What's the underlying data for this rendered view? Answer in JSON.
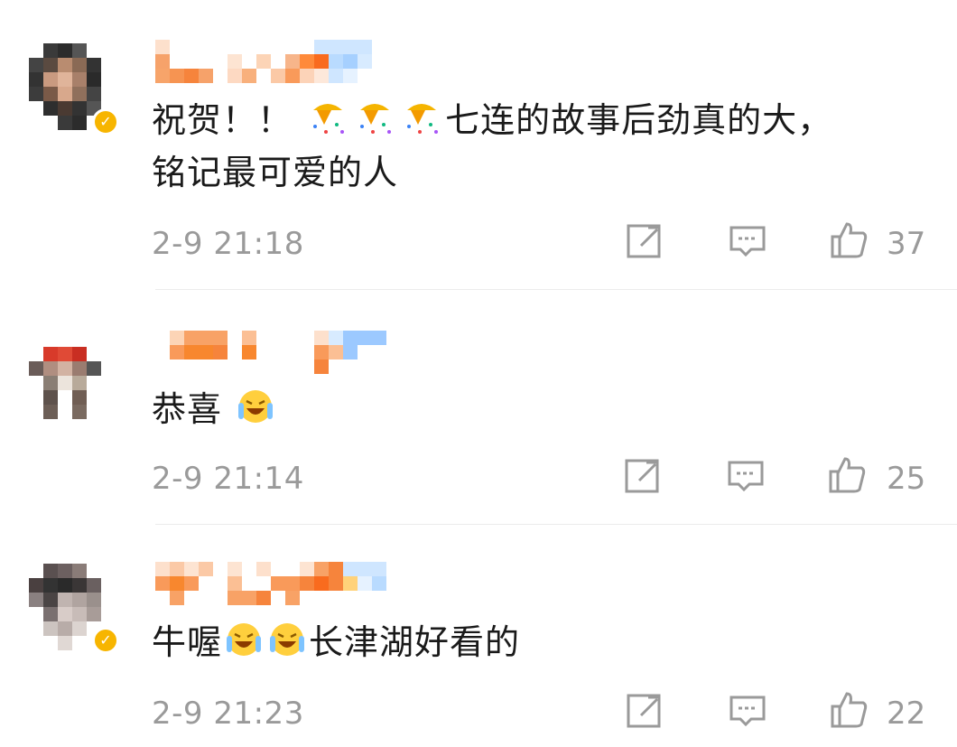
{
  "comments": [
    {
      "text_lines": [
        "祝贺！！",
        "七连的故事后劲真的大，",
        "铭记最可爱的人"
      ],
      "emojis_inline": [
        "party-popper-emoji",
        "party-popper-emoji",
        "party-popper-emoji"
      ],
      "time": "2-9 21:18",
      "likes": "37",
      "verified": true
    },
    {
      "text_lines": [
        "恭喜"
      ],
      "emojis_inline": [
        "laugh-cry-emoji"
      ],
      "time": "2-9 21:14",
      "likes": "25",
      "verified": false
    },
    {
      "text_lines": [
        "牛喔",
        "长津湖好看的"
      ],
      "emojis_inline": [
        "laugh-cry-emoji",
        "laugh-cry-emoji"
      ],
      "time": "2-9 21:23",
      "likes": "22",
      "verified": true
    }
  ],
  "icons": [
    "share-icon",
    "reply-icon",
    "like-icon"
  ],
  "colors": {
    "meta_text": "#9a9a9a",
    "badge": "#f7b500",
    "divider": "#ececec"
  }
}
